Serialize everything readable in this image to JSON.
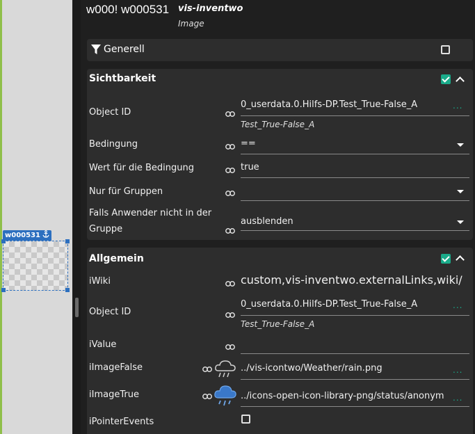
{
  "canvas": {
    "widget_label": "w000531",
    "anchor_icon": "anchor-icon"
  },
  "header": {
    "ids": "w000! w000531",
    "widget_set": "vis-inventwo",
    "widget_type": "Image"
  },
  "generell": {
    "title": "Generell",
    "filter_icon": "filter-icon",
    "checked": false
  },
  "sichtbarkeit": {
    "title": "Sichtbarkeit",
    "checked": true,
    "object_id": {
      "label": "Object ID",
      "value": "0_userdata.0.Hilfs-DP.Test_True-False_A",
      "sub": "Test_True-False_A",
      "dots": "..."
    },
    "bedingung": {
      "label": "Bedingung",
      "value": "=="
    },
    "wert": {
      "label": "Wert für die Bedingung",
      "value": "true"
    },
    "gruppen": {
      "label": "Nur für Gruppen",
      "value": ""
    },
    "falls": {
      "label_line1": "Falls Anwender nicht in der",
      "label_line2": "Gruppe",
      "value": "ausblenden"
    }
  },
  "allgemein": {
    "title": "Allgemein",
    "checked": true,
    "iwiki": {
      "label": "iWiki",
      "value": "custom,vis-inventwo.externalLinks,wiki/"
    },
    "object_id": {
      "label": "Object ID",
      "value": "0_userdata.0.Hilfs-DP.Test_True-False_A",
      "sub": "Test_True-False_A",
      "dots": "..."
    },
    "ivalue": {
      "label": "iValue",
      "value": ""
    },
    "iimagefalse": {
      "label": "iImageFalse",
      "value": "../vis-icontwo/Weather/rain.png",
      "dots": "..."
    },
    "iimagetrue": {
      "label": "iImageTrue",
      "value": "../icons-open-icon-library-png/status/anonym",
      "dots": "..."
    },
    "ipointerevents": {
      "label": "iPointerEvents",
      "checked": false
    }
  },
  "colors": {
    "accent": "#1aab8a",
    "widget_blue": "#2c6fbf",
    "panel_bg": "#2d2d2d"
  }
}
